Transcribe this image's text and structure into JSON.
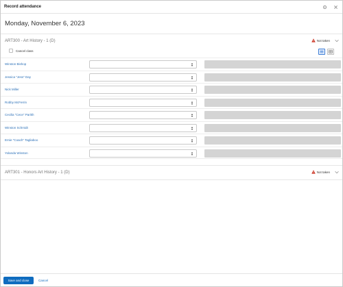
{
  "window": {
    "title": "Record attendance"
  },
  "date_heading": "Monday, November 6, 2023",
  "classes": [
    {
      "name": "ART300 - Art History - 1 (D)",
      "status": "Not taken",
      "cancel_label": "Cancel class",
      "students": [
        {
          "name": "Winston Bishop"
        },
        {
          "name": "Jessica \"Jess\" Day"
        },
        {
          "name": "Nick Miller"
        },
        {
          "name": "Robby McFerrin"
        },
        {
          "name": "Cecilia \"Cece\" Parikh"
        },
        {
          "name": "Winston Schmidt"
        },
        {
          "name": "Ernie \"Coach\" Tagliaboo"
        },
        {
          "name": "Yolanda Winston"
        }
      ]
    },
    {
      "name": "ART301 - Honors Art History - 1 (D)",
      "status": "Not taken"
    }
  ],
  "footer": {
    "save_label": "Save and close",
    "cancel_label": "Cancel"
  },
  "colors": {
    "primary": "#0f6cbf",
    "link": "#2a6fb7",
    "warning": "#ca3120"
  }
}
